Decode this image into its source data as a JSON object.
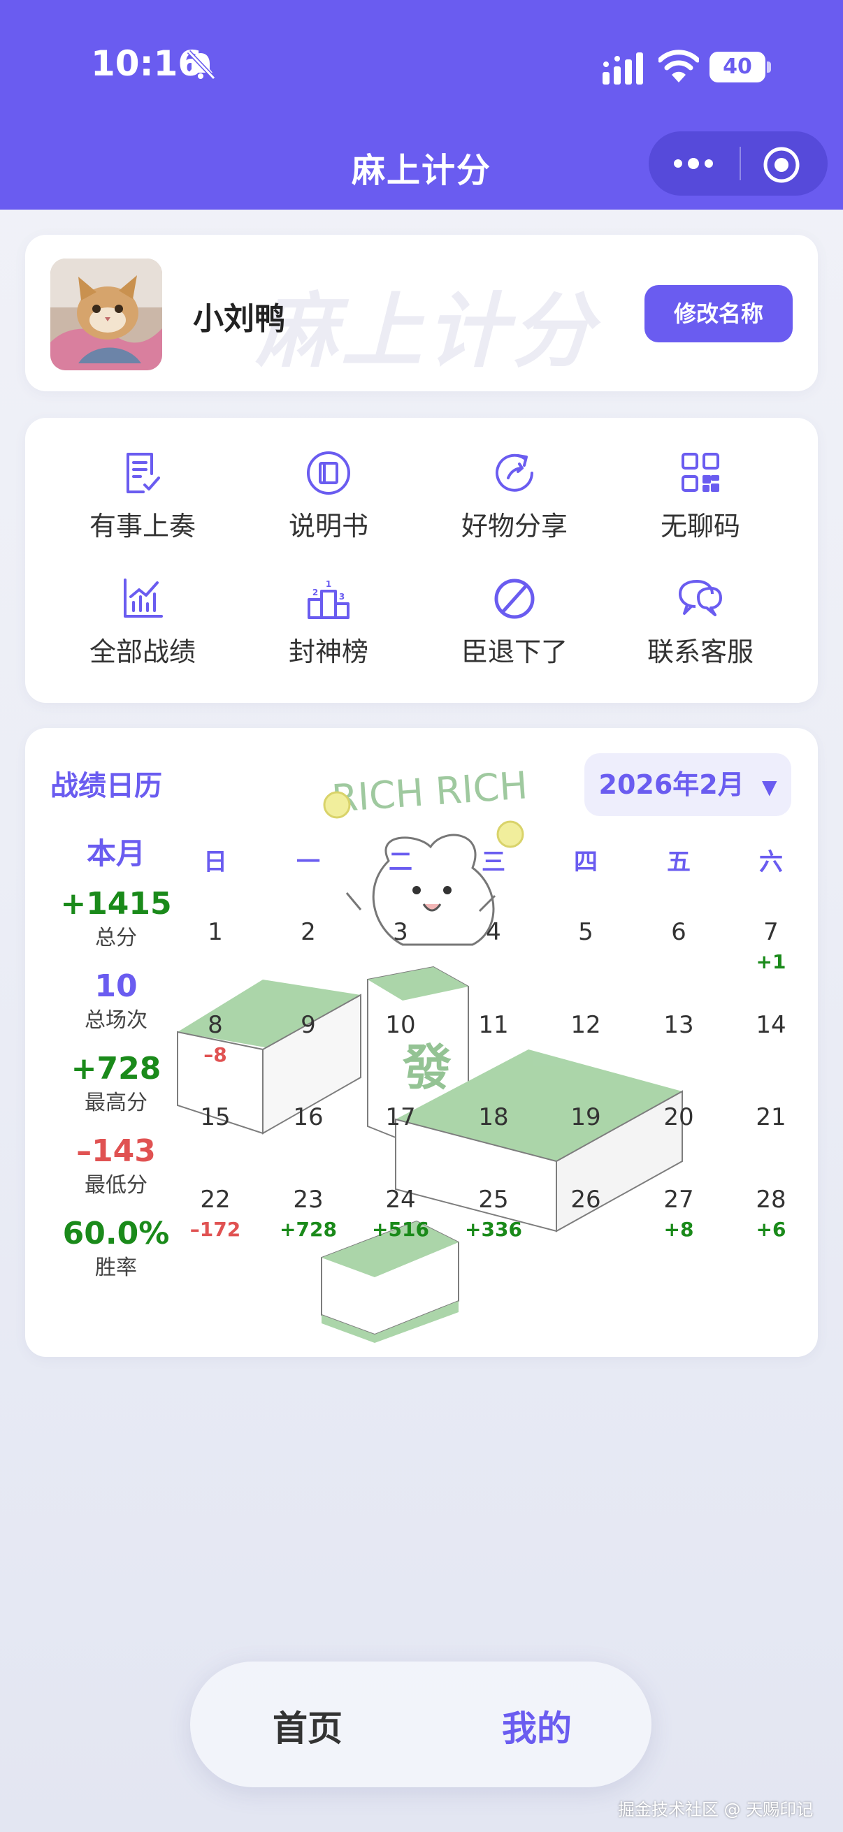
{
  "status_bar": {
    "time": "10:16",
    "battery": "40"
  },
  "nav": {
    "title": "麻上计分"
  },
  "profile": {
    "name": "小刘鸭",
    "watermark": "麻上计分",
    "rename_label": "修改名称"
  },
  "menu": {
    "items": [
      {
        "label": "有事上奏",
        "icon": "report-icon"
      },
      {
        "label": "说明书",
        "icon": "book-icon"
      },
      {
        "label": "好物分享",
        "icon": "share-icon"
      },
      {
        "label": "无聊码",
        "icon": "qrcode-icon"
      },
      {
        "label": "全部战绩",
        "icon": "chart-icon"
      },
      {
        "label": "封神榜",
        "icon": "podium-icon"
      },
      {
        "label": "臣退下了",
        "icon": "ban-icon"
      },
      {
        "label": "联系客服",
        "icon": "chat-icon"
      }
    ]
  },
  "calendar": {
    "title": "战绩日历",
    "month_label": "2026年2月",
    "decoration_text": "RICH RICH",
    "stats": {
      "heading": "本月",
      "items": [
        {
          "value": "+1415",
          "label": "总分"
        },
        {
          "value": "10",
          "label": "总场次"
        },
        {
          "value": "+728",
          "label": "最高分"
        },
        {
          "value": "–143",
          "label": "最低分"
        },
        {
          "value": "60.0%",
          "label": "胜率"
        }
      ]
    },
    "weekdays": [
      "日",
      "一",
      "二",
      "三",
      "四",
      "五",
      "六"
    ],
    "days": [
      {
        "d": "1",
        "s": ""
      },
      {
        "d": "2",
        "s": ""
      },
      {
        "d": "3",
        "s": ""
      },
      {
        "d": "4",
        "s": ""
      },
      {
        "d": "5",
        "s": ""
      },
      {
        "d": "6",
        "s": ""
      },
      {
        "d": "7",
        "s": "+1"
      },
      {
        "d": "8",
        "s": "–8"
      },
      {
        "d": "9",
        "s": ""
      },
      {
        "d": "10",
        "s": ""
      },
      {
        "d": "11",
        "s": ""
      },
      {
        "d": "12",
        "s": ""
      },
      {
        "d": "13",
        "s": ""
      },
      {
        "d": "14",
        "s": ""
      },
      {
        "d": "15",
        "s": ""
      },
      {
        "d": "16",
        "s": ""
      },
      {
        "d": "17",
        "s": ""
      },
      {
        "d": "18",
        "s": ""
      },
      {
        "d": "19",
        "s": ""
      },
      {
        "d": "20",
        "s": ""
      },
      {
        "d": "21",
        "s": ""
      },
      {
        "d": "22",
        "s": "–172"
      },
      {
        "d": "23",
        "s": "+728"
      },
      {
        "d": "24",
        "s": "+516"
      },
      {
        "d": "25",
        "s": "+336"
      },
      {
        "d": "26",
        "s": ""
      },
      {
        "d": "27",
        "s": "+8"
      },
      {
        "d": "28",
        "s": "+6"
      }
    ]
  },
  "tabbar": {
    "home": "首页",
    "mine": "我的"
  },
  "footer": {
    "text": "掘金技术社区 @ 天赐印记"
  },
  "colors": {
    "accent": "#6a5cf0",
    "positive": "#1a8a1a",
    "negative": "#e05252"
  }
}
